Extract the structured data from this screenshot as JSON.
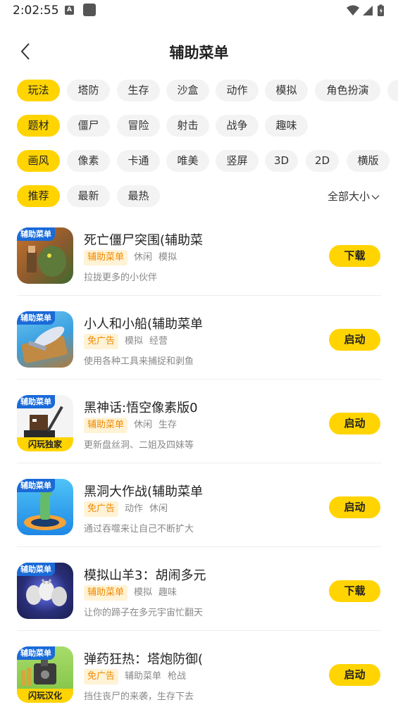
{
  "status_bar": {
    "time": "2:02:55",
    "notification_letter": "A"
  },
  "header": {
    "title": "辅助菜单"
  },
  "filters": {
    "gameplay": [
      "玩法",
      "塔防",
      "生存",
      "沙盒",
      "动作",
      "模拟",
      "角色扮演"
    ],
    "theme": [
      "题材",
      "僵尸",
      "冒险",
      "射击",
      "战争",
      "趣味"
    ],
    "style": [
      "画风",
      "像素",
      "卡通",
      "唯美",
      "竖屏",
      "3D",
      "2D",
      "横版"
    ],
    "sort": [
      "推荐",
      "最新",
      "最热"
    ],
    "size_select": "全部大小"
  },
  "games": [
    {
      "name": "死亡僵尸突围(辅助菜",
      "highlight_tag": "辅助菜单",
      "tags": [
        "休闲",
        "模拟"
      ],
      "description": "拉拢更多的小伙伴",
      "action": "下载",
      "icon_badge": "辅助菜单",
      "icon_footer": "",
      "icon_colors": [
        "#6a4a2a",
        "#c8742a",
        "#3e6b2f"
      ]
    },
    {
      "name": "小人和小船(辅助菜单",
      "highlight_tag": "免广告",
      "tags": [
        "模拟",
        "经营"
      ],
      "description": "使用各种工具来捕捉和剥鱼",
      "action": "启动",
      "icon_badge": "辅助菜单",
      "icon_footer": "",
      "icon_colors": [
        "#3aa0e0",
        "#b07a3a",
        "#e8e8f0"
      ]
    },
    {
      "name": "黑神话:悟空像素版0",
      "highlight_tag": "辅助菜单",
      "tags": [
        "休闲",
        "生存"
      ],
      "description": "更新盘丝洞、二姐及四妹等",
      "action": "启动",
      "icon_badge": "辅助菜单",
      "icon_footer": "闪玩独家",
      "icon_colors": [
        "#f4f4f4",
        "#5a3a22",
        "#2a2a2a"
      ]
    },
    {
      "name": "黑洞大作战(辅助菜单",
      "highlight_tag": "免广告",
      "tags": [
        "动作",
        "休闲"
      ],
      "description": "通过吞噬来让自己不断扩大",
      "action": "启动",
      "icon_badge": "辅助菜单",
      "icon_footer": "",
      "icon_colors": [
        "#1e88e5",
        "#4fc3f7",
        "#66bb6a"
      ]
    },
    {
      "name": "模拟山羊3：胡闹多元",
      "highlight_tag": "辅助菜单",
      "tags": [
        "模拟",
        "趣味"
      ],
      "description": "让你的蹄子在多元宇宙忙翻天",
      "action": "下载",
      "icon_badge": "辅助菜单",
      "icon_footer": "",
      "icon_colors": [
        "#1a1f4d",
        "#6b7bff",
        "#e0e0e0"
      ]
    },
    {
      "name": "弹药狂热：塔炮防御(",
      "highlight_tag": "免广告",
      "tags": [
        "辅助菜单",
        "枪战"
      ],
      "description": "挡住丧尸的来袭，生存下去",
      "action": "启动",
      "icon_badge": "辅助菜单",
      "icon_footer": "闪玩汉化",
      "icon_colors": [
        "#7cc142",
        "#3b3b3b",
        "#d4a73a"
      ]
    }
  ]
}
